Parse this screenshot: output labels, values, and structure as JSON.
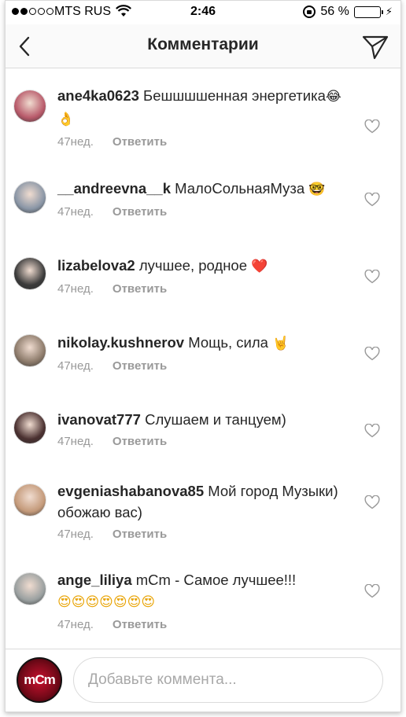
{
  "status_bar": {
    "carrier": "MTS RUS",
    "time": "2:46",
    "battery_percent": "56 %",
    "battery_level": 0.56
  },
  "nav": {
    "title": "Комментарии",
    "back_icon": "chevron-left-icon",
    "send_icon": "paper-plane-icon"
  },
  "comments": [
    {
      "username": "ane4ka0623",
      "text": "Бешшшшенная энергетика",
      "emoji": "😂 👌",
      "age": "47нед.",
      "reply": "Ответить",
      "avatar_color": "#b85a6a"
    },
    {
      "username": "__andreevna__k",
      "text": "МалоСольнаяМуза",
      "emoji": "🤓",
      "age": "47нед.",
      "reply": "Ответить",
      "avatar_color": "#8a96a6"
    },
    {
      "username": "lizabelova2",
      "text": "лучшее, родное",
      "emoji": "❤️",
      "age": "47нед.",
      "reply": "Ответить",
      "avatar_color": "#3a3a3a"
    },
    {
      "username": "nikolay.kushnerov",
      "text": "Мощь, сила",
      "emoji": "🤘",
      "age": "47нед.",
      "reply": "Ответить",
      "avatar_color": "#8c7a6a"
    },
    {
      "username": "ivanovat777",
      "text": "Слушаем и танцуем)",
      "emoji": "",
      "age": "47нед.",
      "reply": "Ответить",
      "avatar_color": "#4a3030"
    },
    {
      "username": "evgeniashabanova85",
      "text": "Мой город Музыки) обожаю вас)",
      "emoji": "",
      "age": "47нед.",
      "reply": "Ответить",
      "avatar_color": "#c49a7a"
    },
    {
      "username": "ange_liliya",
      "text": "mCm - Самое лучшее!!!",
      "emoji": "😍😍😍😍😍😍😍",
      "age": "47нед.",
      "reply": "Ответить",
      "avatar_color": "#9aa0a0"
    }
  ],
  "composer": {
    "avatar_label": "mCm",
    "placeholder": "Добавьте коммента..."
  }
}
